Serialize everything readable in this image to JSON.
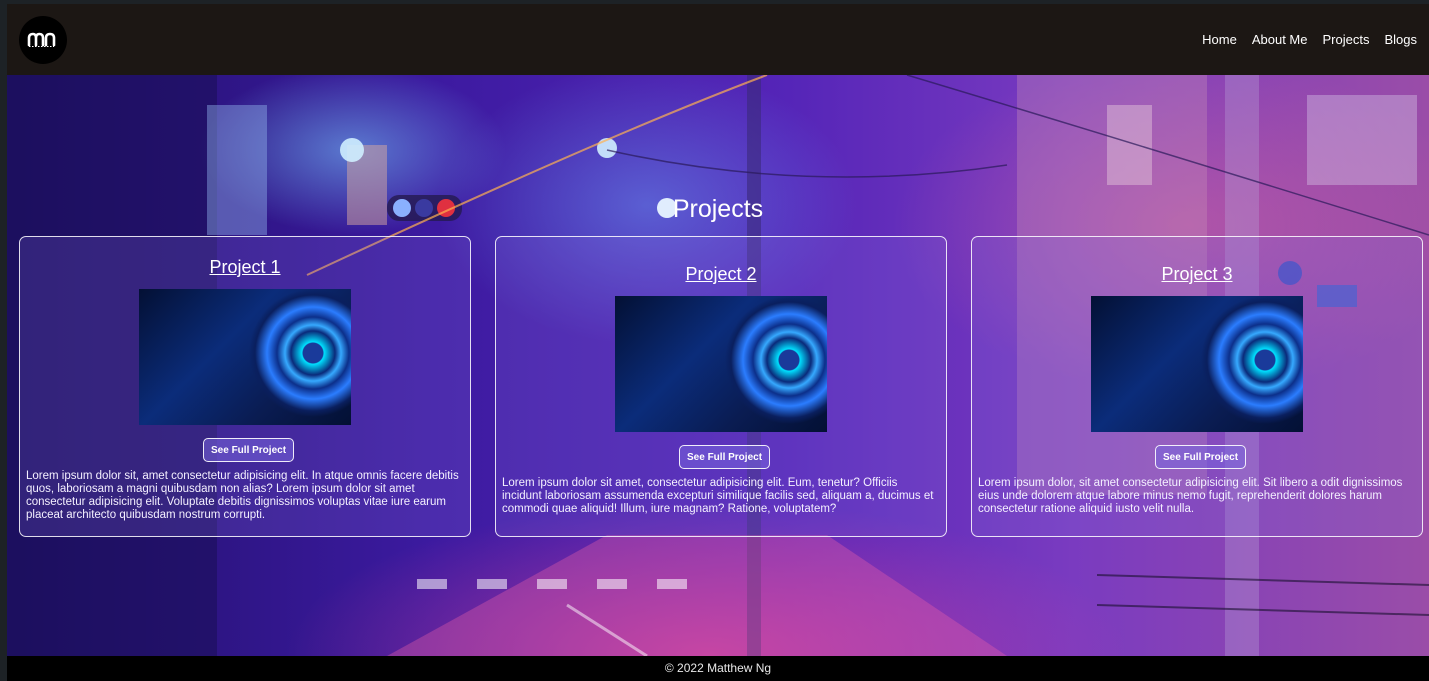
{
  "navbar": {
    "logo_text": "mn",
    "links": [
      {
        "label": "Home"
      },
      {
        "label": "About Me"
      },
      {
        "label": "Projects"
      },
      {
        "label": "Blogs"
      }
    ]
  },
  "projects_section": {
    "title": "Projects",
    "cards": [
      {
        "title": "Project 1",
        "button_label": "See Full Project",
        "description": "Lorem ipsum dolor sit, amet consectetur adipisicing elit. In atque omnis facere debitis quos, laboriosam a magni quibusdam non alias? Lorem ipsum dolor sit amet consectetur adipisicing elit. Voluptate debitis dignissimos voluptas vitae iure earum placeat architecto quibusdam nostrum corrupti."
      },
      {
        "title": "Project 2",
        "button_label": "See Full Project",
        "description": "Lorem ipsum dolor sit amet, consectetur adipisicing elit. Eum, tenetur? Officiis incidunt laboriosam assumenda excepturi similique facilis sed, aliquam a, ducimus et commodi quae aliquid! Illum, iure magnam? Ratione, voluptatem?"
      },
      {
        "title": "Project 3",
        "button_label": "See Full Project",
        "description": "Lorem ipsum dolor, sit amet consectetur adipisicing elit. Sit libero a odit dignissimos eius unde dolorem atque labore minus nemo fugit, reprehenderit dolores harum consectetur ratione aliquid iusto velit nulla."
      }
    ]
  },
  "footer": {
    "copyright": "© 2022 Matthew Ng"
  }
}
